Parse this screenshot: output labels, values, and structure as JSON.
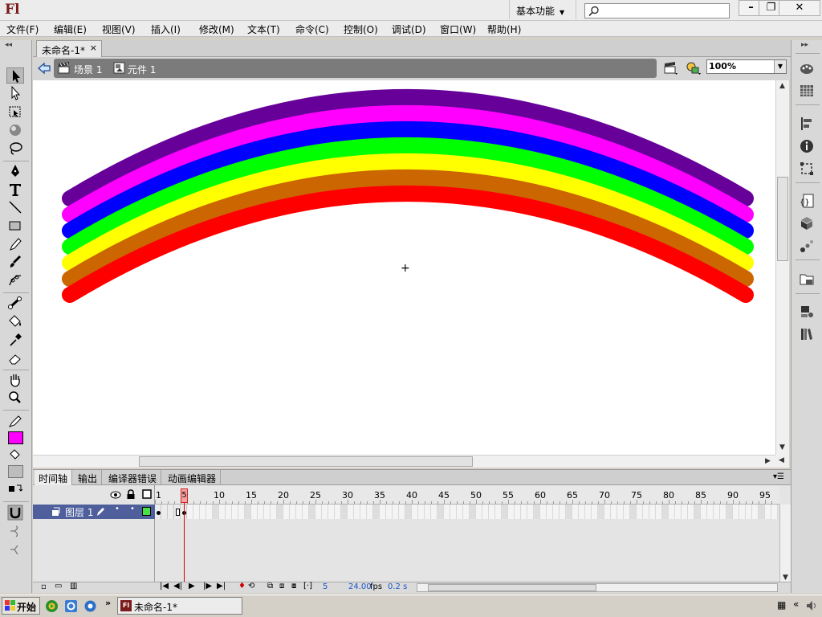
{
  "app": {
    "logo": "Fl",
    "workspace": "基本功能",
    "search_placeholder": ""
  },
  "window_controls": {
    "minimize": "–",
    "restore": "❐",
    "close": "✕"
  },
  "menu": [
    "文件(F)",
    "编辑(E)",
    "视图(V)",
    "插入(I)",
    "修改(M)",
    "文本(T)",
    "命令(C)",
    "控制(O)",
    "调试(D)",
    "窗口(W)",
    "帮助(H)"
  ],
  "document": {
    "tab": "未命名-1*",
    "close": "×"
  },
  "edit_bar": {
    "scene": "场景 1",
    "symbol": "元件 1",
    "zoom": "100%"
  },
  "rainbow_colors": [
    "#660099",
    "#ff00ff",
    "#0000ff",
    "#00ff00",
    "#ffff00",
    "#cc6600",
    "#ff0000"
  ],
  "fill_color": "#ff00ff",
  "timeline": {
    "tabs": [
      "时间轴",
      "输出",
      "编译器错误",
      "动画编辑器"
    ],
    "layer_name": "图层 1",
    "ruler_numbers": [
      "1",
      "5",
      "10",
      "15",
      "20",
      "25",
      "30",
      "35",
      "40",
      "45",
      "50",
      "55",
      "60",
      "65",
      "70",
      "75",
      "80",
      "85",
      "90",
      "95"
    ],
    "current_frame": "5",
    "status_frame": "5",
    "status_fps": "24.00",
    "fps_unit": "fps",
    "status_time": "0.2 s"
  },
  "taskbar": {
    "start": "开始",
    "task": "未命名-1*"
  }
}
